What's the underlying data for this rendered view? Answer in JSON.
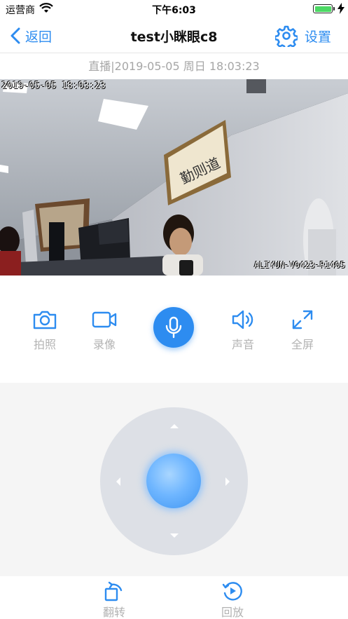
{
  "status_bar": {
    "carrier": "运营商",
    "time": "下午6:03",
    "wifi_icon": "wifi-icon",
    "battery_icon": "battery-charging-icon"
  },
  "nav": {
    "back_label": "返回",
    "title": "test小眯眼c8",
    "settings_label": "设置",
    "accent_color": "#2d8cf0"
  },
  "live_info": "直播|2019-05-05 周日 18:03:23",
  "video": {
    "osd_timestamp": "2019-05-05 18:03:23",
    "osd_device_id": "ALIYUN-V0423-R1405",
    "wall_calligraphy": "勤则道"
  },
  "controls": {
    "photo_label": "拍照",
    "record_label": "录像",
    "talk_icon": "microphone-icon",
    "sound_label": "声音",
    "fullscreen_label": "全屏"
  },
  "ptz": {
    "icons": [
      "arrow-up-icon",
      "arrow-down-icon",
      "arrow-left-icon",
      "arrow-right-icon"
    ]
  },
  "bottom": {
    "flip_label": "翻转",
    "playback_label": "回放"
  }
}
